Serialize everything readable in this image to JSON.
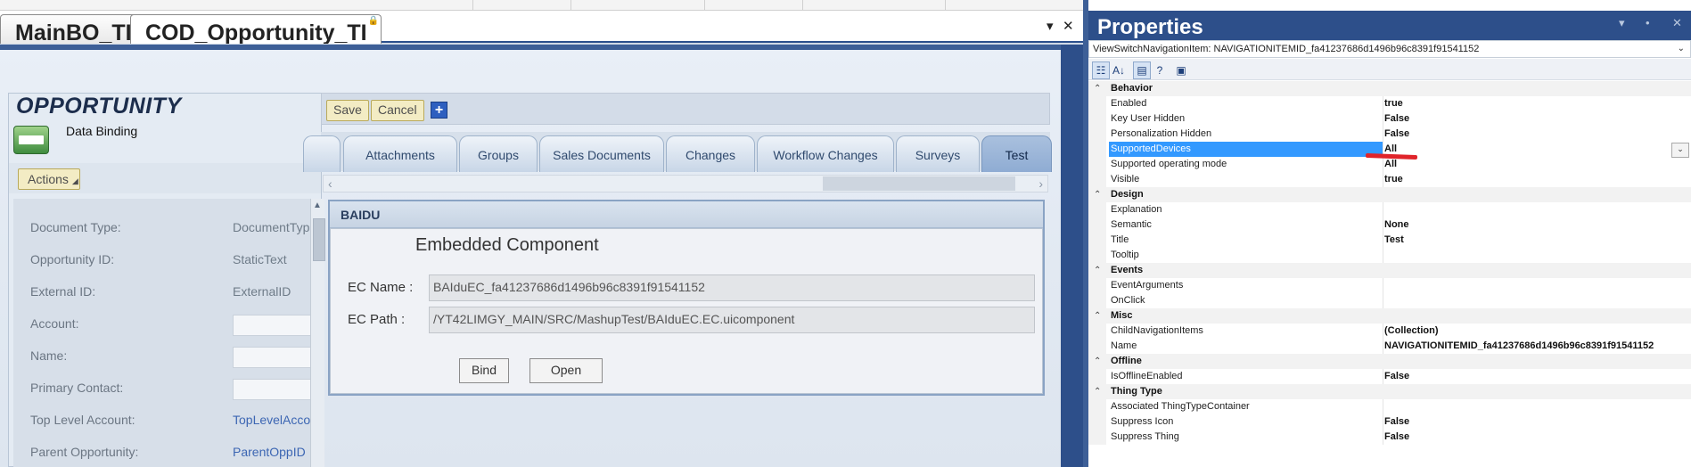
{
  "document_tabs": [
    {
      "label": "MainBO_TI",
      "active": false
    },
    {
      "label": "COD_Opportunity_TI",
      "active": true,
      "locked": true
    }
  ],
  "tab_controls": {
    "dropdown": "▾",
    "close": "✕"
  },
  "opportunity": {
    "title": "OPPORTUNITY",
    "subtitle": "Data Binding",
    "actions_label": "Actions",
    "fields": [
      {
        "label": "Document Type:",
        "value": "DocumentTyp",
        "kind": "text"
      },
      {
        "label": "Opportunity ID:",
        "value": "StaticText",
        "kind": "text"
      },
      {
        "label": "External ID:",
        "value": "ExternalID",
        "kind": "text"
      },
      {
        "label": "Account:",
        "value": "",
        "kind": "input"
      },
      {
        "label": "Name:",
        "value": "",
        "kind": "input"
      },
      {
        "label": "Primary Contact:",
        "value": "",
        "kind": "input"
      },
      {
        "label": "Top Level Account:",
        "value": "TopLevelAcco",
        "kind": "link"
      },
      {
        "label": "Parent Opportunity:",
        "value": "ParentOppID",
        "kind": "link"
      }
    ]
  },
  "toolbar": {
    "save_label": "Save",
    "cancel_label": "Cancel",
    "add_label": "+"
  },
  "view_tabs": [
    {
      "label": "",
      "active": false
    },
    {
      "label": "Attachments",
      "active": false
    },
    {
      "label": "Groups",
      "active": false
    },
    {
      "label": "Sales Documents",
      "active": false
    },
    {
      "label": "Changes",
      "active": false
    },
    {
      "label": "Workflow Changes",
      "active": false
    },
    {
      "label": "Surveys",
      "active": false
    },
    {
      "label": "Test",
      "active": true
    }
  ],
  "embedded": {
    "header": "BAIDU",
    "title": "Embedded Component",
    "ec_name_label": "EC Name :",
    "ec_name_value": "BAIduEC_fa41237686d1496b96c8391f91541152",
    "ec_path_label": "EC Path :",
    "ec_path_value": "/YT42LIMGY_MAIN/SRC/MashupTest/BAIduEC.EC.uicomponent",
    "bind_label": "Bind",
    "open_label": "Open"
  },
  "properties": {
    "title": "Properties",
    "selector": "ViewSwitchNavigationItem: NAVIGATIONITEMID_fa41237686d1496b96c8391f91541152",
    "categories": [
      {
        "name": "Behavior",
        "rows": [
          {
            "name": "Enabled",
            "value": "true"
          },
          {
            "name": "Key User Hidden",
            "value": "False"
          },
          {
            "name": "Personalization Hidden",
            "value": "False"
          },
          {
            "name": "SupportedDevices",
            "value": "All",
            "selected": true
          },
          {
            "name": "Supported operating mode",
            "value": "All"
          },
          {
            "name": "Visible",
            "value": "true"
          }
        ]
      },
      {
        "name": "Design",
        "rows": [
          {
            "name": "Explanation",
            "value": ""
          },
          {
            "name": "Semantic",
            "value": "None"
          },
          {
            "name": "Title",
            "value": "Test"
          },
          {
            "name": "Tooltip",
            "value": ""
          }
        ]
      },
      {
        "name": "Events",
        "rows": [
          {
            "name": "EventArguments",
            "value": ""
          },
          {
            "name": "OnClick",
            "value": ""
          }
        ]
      },
      {
        "name": "Misc",
        "rows": [
          {
            "name": "ChildNavigationItems",
            "value": "(Collection)"
          },
          {
            "name": "Name",
            "value": "NAVIGATIONITEMID_fa41237686d1496b96c8391f91541152"
          }
        ]
      },
      {
        "name": "Offline",
        "rows": [
          {
            "name": "IsOfflineEnabled",
            "value": "False"
          }
        ]
      },
      {
        "name": "Thing Type",
        "rows": [
          {
            "name": "Associated ThingTypeContainer",
            "value": ""
          },
          {
            "name": "Suppress Icon",
            "value": "False"
          },
          {
            "name": "Suppress Thing",
            "value": "False"
          }
        ]
      }
    ]
  },
  "colors": {
    "title_bar": "#2d4f8a",
    "selection": "#3399ff",
    "annotation": "#e0242a",
    "button_yellow": "#f3ecc4"
  }
}
